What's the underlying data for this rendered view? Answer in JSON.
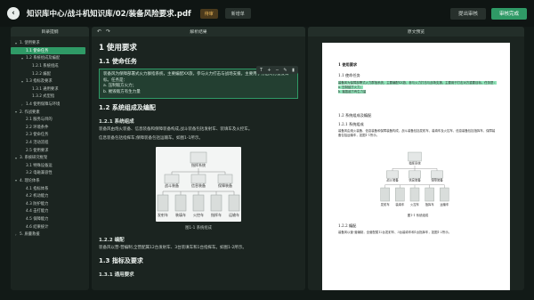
{
  "header": {
    "title": "知识库中心/战斗机知识库/02/装备风险要求.pdf",
    "badge": "待审",
    "secondary_btn": "新增单",
    "btn_reject": "提出审核",
    "btn_approve": "审核完成"
  },
  "left": {
    "title": "目录提纲",
    "items": [
      {
        "label": "1. 使用要求",
        "level": 0,
        "caret": "▾"
      },
      {
        "label": "1.1 使命任务",
        "level": 1,
        "caret": "",
        "selected": true
      },
      {
        "label": "1.2 系统组成及编配",
        "level": 1,
        "caret": "▾"
      },
      {
        "label": "1.2.1 系统组成",
        "level": 2,
        "caret": ""
      },
      {
        "label": "1.2.2 编配",
        "level": 2,
        "caret": ""
      },
      {
        "label": "1.3 指标及要求",
        "level": 1,
        "caret": "▾"
      },
      {
        "label": "1.3.1 通用要求",
        "level": 2,
        "caret": ""
      },
      {
        "label": "1.3.2 式型指",
        "level": 2,
        "caret": ""
      },
      {
        "label": "1.4 使用保障与环境",
        "level": 1,
        "caret": "›"
      },
      {
        "label": "2. 作战要素",
        "level": 0,
        "caret": "▾"
      },
      {
        "label": "2.1 服务与目的",
        "level": 1,
        "caret": ""
      },
      {
        "label": "2.2 环境条件",
        "level": 1,
        "caret": ""
      },
      {
        "label": "2.3 使命任务",
        "level": 1,
        "caret": ""
      },
      {
        "label": "2.4 活动流程",
        "level": 1,
        "caret": ""
      },
      {
        "label": "2.5 使用要求",
        "level": 1,
        "caret": ""
      },
      {
        "label": "3. 系统研究框架",
        "level": 0,
        "caret": "▾"
      },
      {
        "label": "3.1 特殊设备运",
        "level": 1,
        "caret": ""
      },
      {
        "label": "3.2 电磁兼容性",
        "level": 1,
        "caret": ""
      },
      {
        "label": "4. 理论体系",
        "level": 0,
        "caret": "▾"
      },
      {
        "label": "4.1 指标体系",
        "level": 1,
        "caret": ""
      },
      {
        "label": "4.2 机动能力",
        "level": 1,
        "caret": ""
      },
      {
        "label": "4.3 防护能力",
        "level": 1,
        "caret": ""
      },
      {
        "label": "4.4 击打能力",
        "level": 1,
        "caret": ""
      },
      {
        "label": "4.5 保障能力",
        "level": 1,
        "caret": ""
      },
      {
        "label": "4.6 结果统计",
        "level": 1,
        "caret": ""
      },
      {
        "label": "5. 质量救援",
        "level": 0,
        "caret": "›"
      }
    ]
  },
  "mid": {
    "title": "解析结果",
    "undo": "↶",
    "redo": "↷",
    "h1": "1 使用要求",
    "h2_a": "1.1 使命任务",
    "sel_text": "装备风为保障部署式火力群指系统，主要编配XX旅，参与火力打击与战场支援。主要用于打击对方重要目标。任务是：",
    "sel_a": "a. 压制敌方火力；",
    "sel_b": "b. 摧毁敌方有生力量",
    "h2_b": "1.2 系统组成及编配",
    "h3_a": "1.2.1 系统组成",
    "p1": "装备风由炮火装备、信息装备和保障装备构成,战斗装备包括发射车、装填车及火控车。",
    "p2": "信息装备包括指挥车;保障装备包括运输车。如图1-1所示。",
    "fig_caption": "图1-1 系统组成",
    "h3_b": "1.2.2 编配",
    "p3": "装备风以营-营编制,全营配属12台发射车、3台装填车和1台指挥车。如图1-2所示。",
    "h2_c": "1.3 指标及要求",
    "h3_c": "1.3.1 通用要求",
    "fmt_tools": [
      "T",
      "+",
      "−",
      "✎",
      "▮"
    ]
  },
  "right": {
    "title": "原文预览",
    "pdf": {
      "h1": "1 使用要求",
      "h2": "1.1 使命任务",
      "hl1": "装备风为保障部署式火力群指系统，主要编配XX旅，参与火力打击与战场支援",
      "hl2": "。主要用于打击对方重要目标。任务是：",
      "hl3": "a. 压制敌方火力；",
      "hl4": "b. 摧毁敌方有生力量",
      "h2b": "1.2 系统组成及编配",
      "h3": "1.2.1 系统组成",
      "p1": "装备风由炮火装备、信息装备和保障装备构成，战斗装备包括发射车、装填车及火控车，信息装备包括指挥车，保障装备包括运输车，如图1-1所示。",
      "cap": "图1-1 系统组成",
      "h3b": "1.2.2 编配",
      "p2": "装备风以营-营编制，全营配属12台发射车、3台装填车和1台指挥车，如图1-2所示。"
    }
  },
  "colors": {
    "accent": "#2f9a66",
    "bg": "#121a17",
    "panel": "#1b2420"
  },
  "figure": {
    "root": "指挥系统",
    "l1": [
      "战斗装备",
      "信息装备",
      "保障装备"
    ],
    "l2": [
      "发射车",
      "装填车",
      "火控车",
      "指挥车",
      "运输车"
    ]
  }
}
